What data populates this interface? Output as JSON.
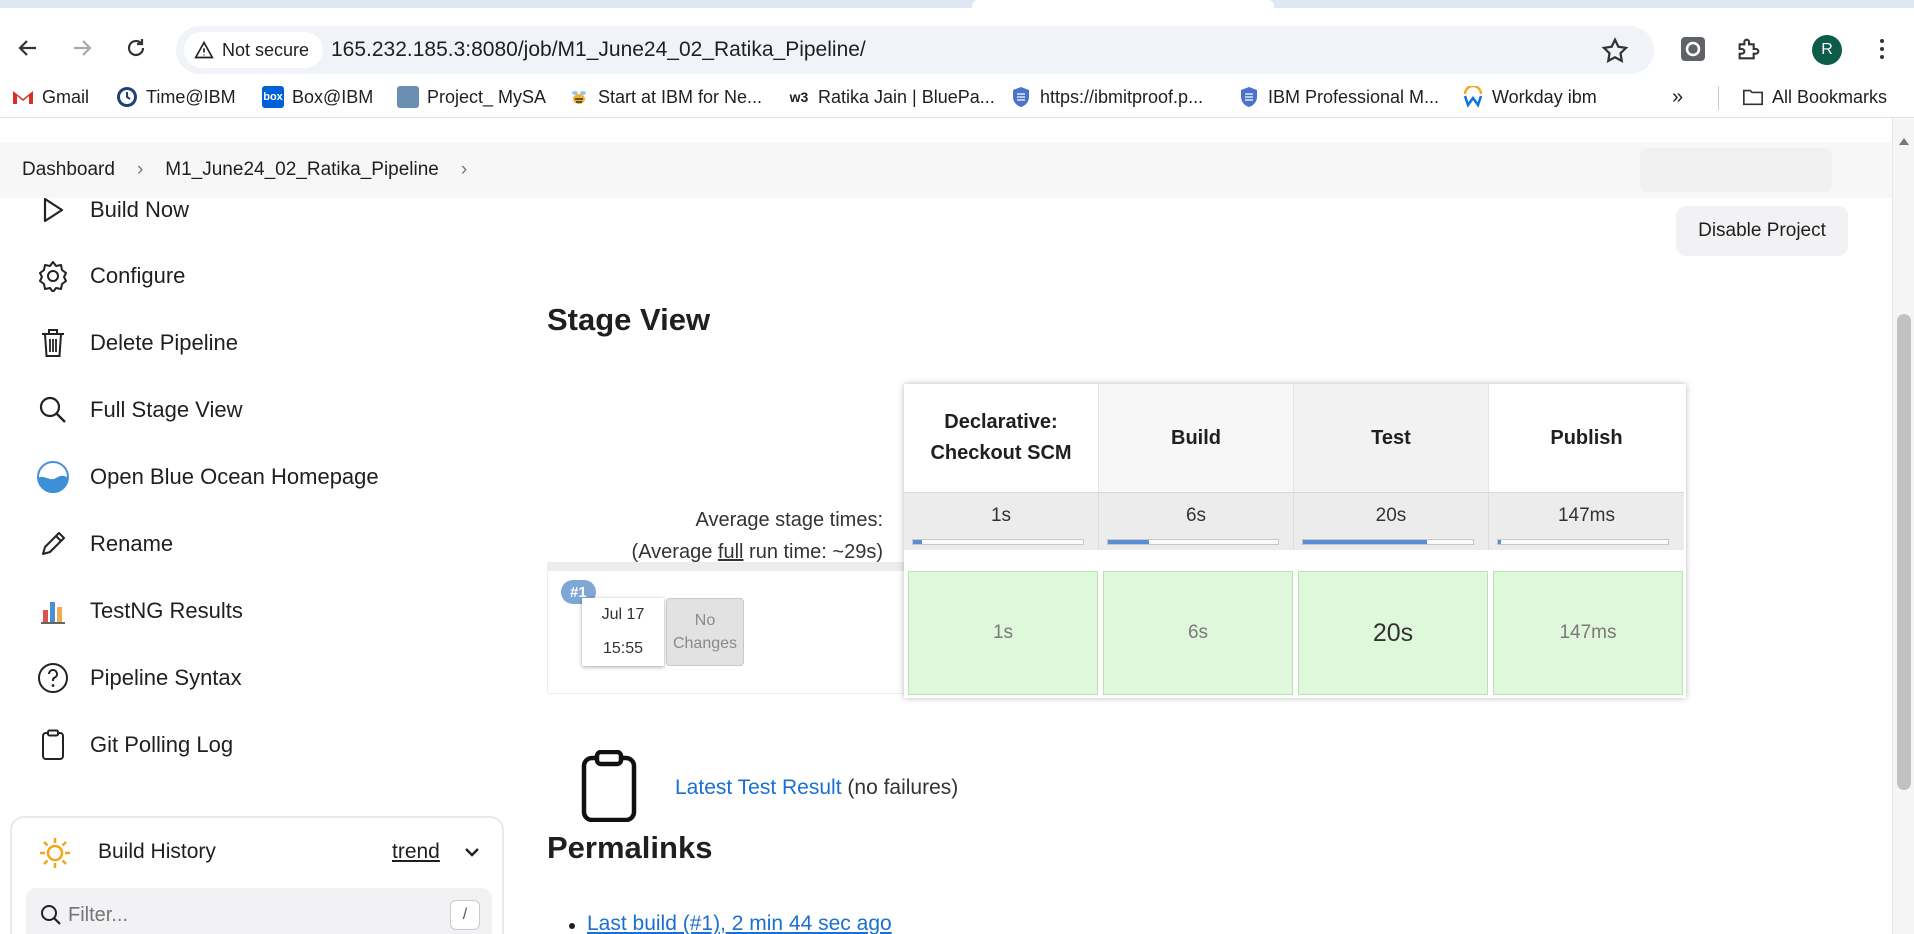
{
  "browser": {
    "security_label": "Not secure",
    "url": "165.232.185.3:8080/job/M1_June24_02_Ratika_Pipeline/",
    "profile_initial": "R",
    "bookmarks": [
      {
        "label": "Gmail",
        "icon": "gmail-icon"
      },
      {
        "label": "Time@IBM",
        "icon": "clock-icon"
      },
      {
        "label": "Box@IBM",
        "icon": "box-icon"
      },
      {
        "label": "Project_ MySA",
        "icon": "project-icon"
      },
      {
        "label": "Start at IBM for Ne...",
        "icon": "bee-icon"
      },
      {
        "label": "Ratika Jain | BluePa...",
        "icon": "w3-icon"
      },
      {
        "label": "https://ibmitproof.p...",
        "icon": "shield-icon"
      },
      {
        "label": "IBM Professional M...",
        "icon": "shield-icon"
      },
      {
        "label": "Workday ibm",
        "icon": "workday-icon"
      }
    ],
    "all_bookmarks": "All Bookmarks"
  },
  "breadcrumb": {
    "dashboard": "Dashboard",
    "job": "M1_June24_02_Ratika_Pipeline"
  },
  "sidebar": {
    "tasks": [
      {
        "label": "Build Now",
        "icon": "play-icon"
      },
      {
        "label": "Configure",
        "icon": "gear-icon"
      },
      {
        "label": "Delete Pipeline",
        "icon": "trash-icon"
      },
      {
        "label": "Full Stage View",
        "icon": "search-icon"
      },
      {
        "label": "Open Blue Ocean Homepage",
        "icon": "blue-ocean-icon"
      },
      {
        "label": "Rename",
        "icon": "pencil-icon"
      },
      {
        "label": "TestNG Results",
        "icon": "bar-chart-icon"
      },
      {
        "label": "Pipeline Syntax",
        "icon": "help-icon"
      },
      {
        "label": "Git Polling Log",
        "icon": "clipboard-icon"
      }
    ],
    "build_history": {
      "title": "Build History",
      "trend": "trend",
      "filter_placeholder": "Filter...",
      "shortcut": "/"
    }
  },
  "main": {
    "disable_button": "Disable Project",
    "stage_view_title": "Stage View",
    "average_label_line1": "Average stage times:",
    "average_label_pre": "(Average ",
    "average_label_full": "full",
    "average_label_post": " run time: ~29s)",
    "stages": [
      {
        "name_line1": "Declarative:",
        "name_line2": "Checkout SCM",
        "avg": "1s",
        "avg_fraction": 0.05,
        "run_time": "1s"
      },
      {
        "name_line1": "Build",
        "name_line2": "",
        "avg": "6s",
        "avg_fraction": 0.24,
        "run_time": "6s"
      },
      {
        "name_line1": "Test",
        "name_line2": "",
        "avg": "20s",
        "avg_fraction": 0.73,
        "run_time": "20s"
      },
      {
        "name_line1": "Publish",
        "name_line2": "",
        "avg": "147ms",
        "avg_fraction": 0.01,
        "run_time": "147ms"
      }
    ],
    "build": {
      "number": "#1",
      "date": "Jul 17",
      "time": "15:55",
      "changes_line1": "No",
      "changes_line2": "Changes"
    },
    "latest_test_link": "Latest Test Result",
    "latest_test_note": "(no failures)",
    "permalinks_title": "Permalinks",
    "permalinks": [
      "Last build (#1), 2 min 44 sec ago"
    ]
  }
}
